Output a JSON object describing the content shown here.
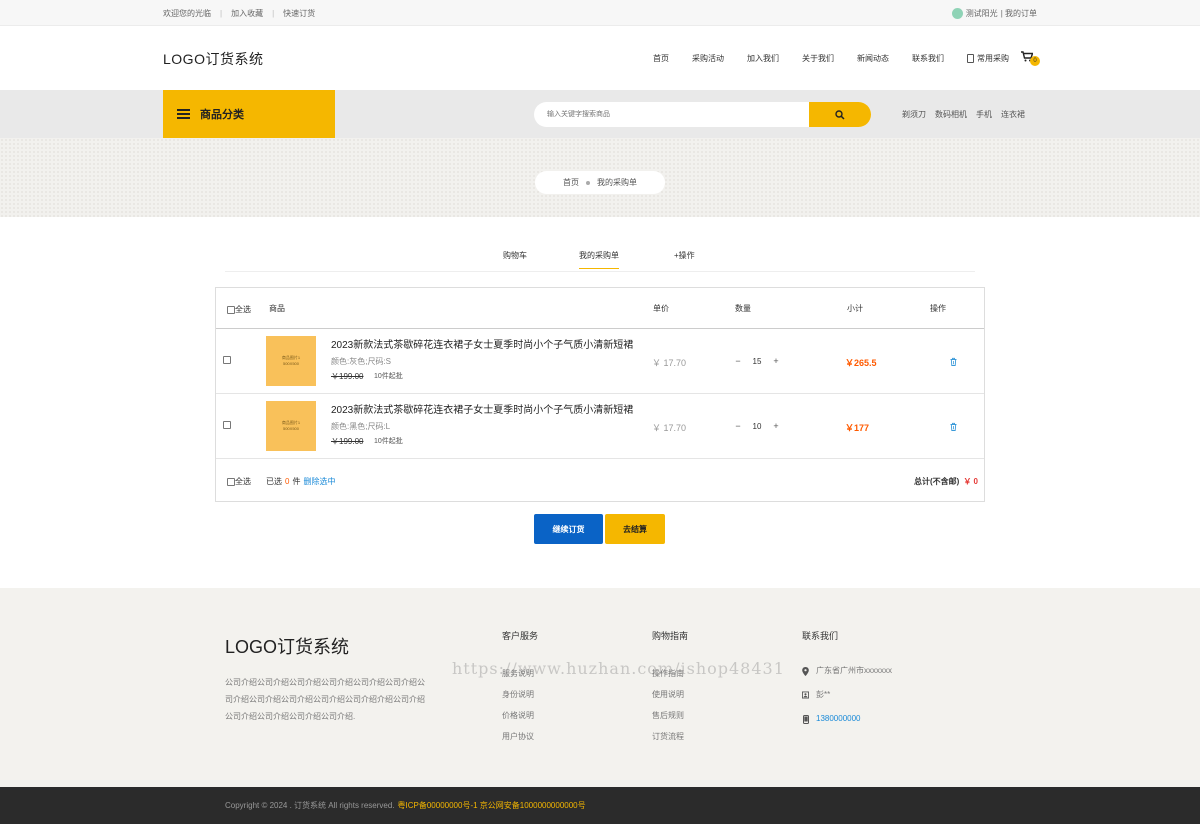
{
  "topbar": {
    "welcome": "欢迎您的光临",
    "favorite": "加入收藏",
    "quick_order": "快速订货",
    "username": "测试阳光",
    "my_orders": "| 我的订单"
  },
  "header": {
    "logo": "LOGO订货系统",
    "nav": [
      "首页",
      "采购活动",
      "加入我们",
      "关于我们",
      "新闻动态",
      "联系我们"
    ],
    "common_purchase": "常用采购",
    "cart_count": "0"
  },
  "catbar": {
    "category_label": "商品分类",
    "search_placeholder": "输入关键字搜索商品",
    "hotwords": [
      "剃须刀",
      "数码相机",
      "手机",
      "连衣裙"
    ]
  },
  "breadcrumb": {
    "home": "首页",
    "current": "我的采购单"
  },
  "tabs": [
    "购物车",
    "我的采购单",
    "+操作"
  ],
  "table": {
    "headers": {
      "select_all": "全选",
      "product": "商品",
      "unit_price": "单价",
      "quantity": "数量",
      "subtotal": "小计",
      "action": "操作"
    },
    "rows": [
      {
        "thumb_line1": "商品图片1",
        "thumb_line2": "500X500",
        "title": "2023新款法式茶歇碎花连衣裙子女士夏季时尚小个子气质小清新短裙",
        "attrs": "颜色:灰色;尺码:S",
        "old_price": "￥199.00",
        "min_order": "10件起批",
        "unit_price": "￥ 17.70",
        "qty": "15",
        "subtotal": "￥265.5"
      },
      {
        "thumb_line1": "商品图片1",
        "thumb_line2": "500X500",
        "title": "2023新款法式茶歇碎花连衣裙子女士夏季时尚小个子气质小清新短裙",
        "attrs": "颜色:黑色;尺码:L",
        "old_price": "￥199.00",
        "min_order": "10件起批",
        "unit_price": "￥ 17.70",
        "qty": "10",
        "subtotal": "￥177"
      }
    ],
    "footer": {
      "select_all": "全选",
      "selected_prefix": "已选",
      "selected_count": "0",
      "selected_suffix": "件",
      "delete_selected": "删除选中",
      "total_label": "总计(不含邮)",
      "total_value": "￥ 0"
    },
    "minus": "−",
    "plus": "+"
  },
  "buttons": {
    "continue": "继续订货",
    "checkout": "去结算"
  },
  "footer": {
    "logo": "LOGO订货系统",
    "intro": "公司介绍公司介绍公司介绍公司介绍公司介绍公司介绍公司介绍公司介绍公司介绍公司介绍公司介绍介绍公司介绍公司介绍公司介绍公司介绍公司介绍.",
    "service": {
      "title": "客户服务",
      "items": [
        "服务说明",
        "身份说明",
        "价格说明",
        "用户协议"
      ]
    },
    "guide": {
      "title": "购物指南",
      "items": [
        "操作指南",
        "使用说明",
        "售后规则",
        "订货流程"
      ]
    },
    "contact": {
      "title": "联系我们",
      "address": "广东省广州市xxxxxxx",
      "person": "彭**",
      "phone": "1380000000"
    },
    "watermark": "https://www.huzhan.com/ishop48431"
  },
  "copyright": {
    "text": "Copyright © 2024 . 订货系统 All rights reserved.",
    "icp": "粤ICP备00000000号-1 京公网安备1000000000000号"
  },
  "colors": {
    "accent": "#f5b700",
    "primary_blue": "#0a63c6",
    "price_orange": "#ff5a00"
  }
}
